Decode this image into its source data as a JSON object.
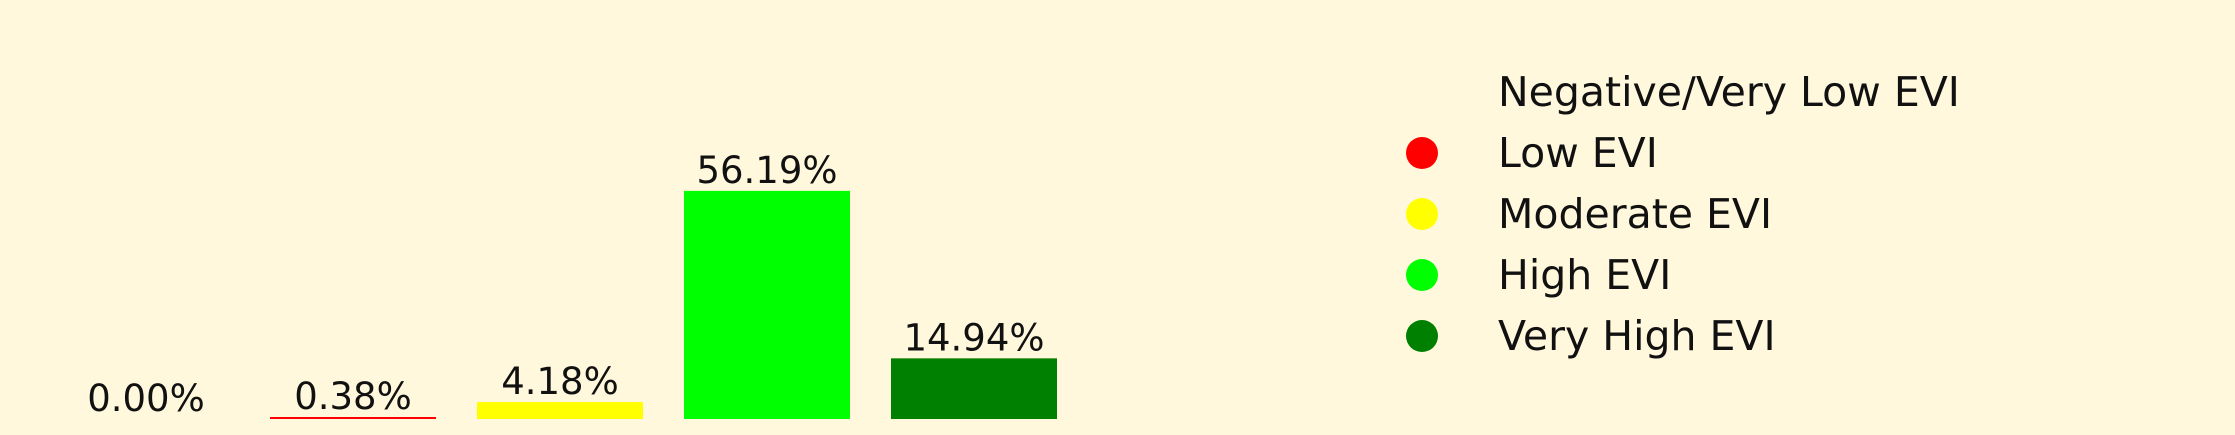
{
  "chart_data": {
    "type": "bar",
    "categories": [
      "Negative/Very Low EVI",
      "Low EVI",
      "Moderate EVI",
      "High EVI",
      "Very High EVI"
    ],
    "values": [
      0.0,
      0.38,
      4.18,
      56.19,
      14.94
    ],
    "value_labels": [
      "0.00%",
      "0.38%",
      "4.18%",
      "56.19%",
      "14.94%"
    ],
    "colors": [
      "#fff8dc",
      "#ff0000",
      "#ffff00",
      "#00ff00",
      "#008000"
    ],
    "ylim": [
      0,
      60
    ],
    "grid": false,
    "legend": {
      "placement": "right",
      "entries": [
        "Negative/Very Low EVI",
        "Low EVI",
        "Moderate EVI",
        "High EVI",
        "Very High EVI"
      ]
    },
    "background": "#fff8dc"
  }
}
